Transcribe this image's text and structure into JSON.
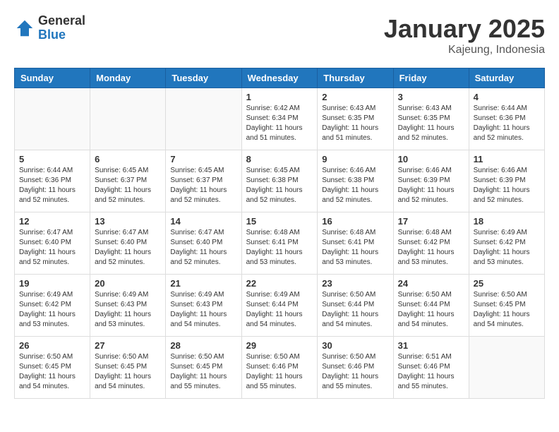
{
  "logo": {
    "general": "General",
    "blue": "Blue"
  },
  "title": "January 2025",
  "location": "Kajeung, Indonesia",
  "days_of_week": [
    "Sunday",
    "Monday",
    "Tuesday",
    "Wednesday",
    "Thursday",
    "Friday",
    "Saturday"
  ],
  "weeks": [
    [
      {
        "day": "",
        "sunrise": "",
        "sunset": "",
        "daylight": "",
        "empty": true
      },
      {
        "day": "",
        "sunrise": "",
        "sunset": "",
        "daylight": "",
        "empty": true
      },
      {
        "day": "",
        "sunrise": "",
        "sunset": "",
        "daylight": "",
        "empty": true
      },
      {
        "day": "1",
        "sunrise": "Sunrise: 6:42 AM",
        "sunset": "Sunset: 6:34 PM",
        "daylight": "Daylight: 11 hours and 51 minutes."
      },
      {
        "day": "2",
        "sunrise": "Sunrise: 6:43 AM",
        "sunset": "Sunset: 6:35 PM",
        "daylight": "Daylight: 11 hours and 51 minutes."
      },
      {
        "day": "3",
        "sunrise": "Sunrise: 6:43 AM",
        "sunset": "Sunset: 6:35 PM",
        "daylight": "Daylight: 11 hours and 52 minutes."
      },
      {
        "day": "4",
        "sunrise": "Sunrise: 6:44 AM",
        "sunset": "Sunset: 6:36 PM",
        "daylight": "Daylight: 11 hours and 52 minutes."
      }
    ],
    [
      {
        "day": "5",
        "sunrise": "Sunrise: 6:44 AM",
        "sunset": "Sunset: 6:36 PM",
        "daylight": "Daylight: 11 hours and 52 minutes."
      },
      {
        "day": "6",
        "sunrise": "Sunrise: 6:45 AM",
        "sunset": "Sunset: 6:37 PM",
        "daylight": "Daylight: 11 hours and 52 minutes."
      },
      {
        "day": "7",
        "sunrise": "Sunrise: 6:45 AM",
        "sunset": "Sunset: 6:37 PM",
        "daylight": "Daylight: 11 hours and 52 minutes."
      },
      {
        "day": "8",
        "sunrise": "Sunrise: 6:45 AM",
        "sunset": "Sunset: 6:38 PM",
        "daylight": "Daylight: 11 hours and 52 minutes."
      },
      {
        "day": "9",
        "sunrise": "Sunrise: 6:46 AM",
        "sunset": "Sunset: 6:38 PM",
        "daylight": "Daylight: 11 hours and 52 minutes."
      },
      {
        "day": "10",
        "sunrise": "Sunrise: 6:46 AM",
        "sunset": "Sunset: 6:39 PM",
        "daylight": "Daylight: 11 hours and 52 minutes."
      },
      {
        "day": "11",
        "sunrise": "Sunrise: 6:46 AM",
        "sunset": "Sunset: 6:39 PM",
        "daylight": "Daylight: 11 hours and 52 minutes."
      }
    ],
    [
      {
        "day": "12",
        "sunrise": "Sunrise: 6:47 AM",
        "sunset": "Sunset: 6:40 PM",
        "daylight": "Daylight: 11 hours and 52 minutes."
      },
      {
        "day": "13",
        "sunrise": "Sunrise: 6:47 AM",
        "sunset": "Sunset: 6:40 PM",
        "daylight": "Daylight: 11 hours and 52 minutes."
      },
      {
        "day": "14",
        "sunrise": "Sunrise: 6:47 AM",
        "sunset": "Sunset: 6:40 PM",
        "daylight": "Daylight: 11 hours and 52 minutes."
      },
      {
        "day": "15",
        "sunrise": "Sunrise: 6:48 AM",
        "sunset": "Sunset: 6:41 PM",
        "daylight": "Daylight: 11 hours and 53 minutes."
      },
      {
        "day": "16",
        "sunrise": "Sunrise: 6:48 AM",
        "sunset": "Sunset: 6:41 PM",
        "daylight": "Daylight: 11 hours and 53 minutes."
      },
      {
        "day": "17",
        "sunrise": "Sunrise: 6:48 AM",
        "sunset": "Sunset: 6:42 PM",
        "daylight": "Daylight: 11 hours and 53 minutes."
      },
      {
        "day": "18",
        "sunrise": "Sunrise: 6:49 AM",
        "sunset": "Sunset: 6:42 PM",
        "daylight": "Daylight: 11 hours and 53 minutes."
      }
    ],
    [
      {
        "day": "19",
        "sunrise": "Sunrise: 6:49 AM",
        "sunset": "Sunset: 6:42 PM",
        "daylight": "Daylight: 11 hours and 53 minutes."
      },
      {
        "day": "20",
        "sunrise": "Sunrise: 6:49 AM",
        "sunset": "Sunset: 6:43 PM",
        "daylight": "Daylight: 11 hours and 53 minutes."
      },
      {
        "day": "21",
        "sunrise": "Sunrise: 6:49 AM",
        "sunset": "Sunset: 6:43 PM",
        "daylight": "Daylight: 11 hours and 54 minutes."
      },
      {
        "day": "22",
        "sunrise": "Sunrise: 6:49 AM",
        "sunset": "Sunset: 6:44 PM",
        "daylight": "Daylight: 11 hours and 54 minutes."
      },
      {
        "day": "23",
        "sunrise": "Sunrise: 6:50 AM",
        "sunset": "Sunset: 6:44 PM",
        "daylight": "Daylight: 11 hours and 54 minutes."
      },
      {
        "day": "24",
        "sunrise": "Sunrise: 6:50 AM",
        "sunset": "Sunset: 6:44 PM",
        "daylight": "Daylight: 11 hours and 54 minutes."
      },
      {
        "day": "25",
        "sunrise": "Sunrise: 6:50 AM",
        "sunset": "Sunset: 6:45 PM",
        "daylight": "Daylight: 11 hours and 54 minutes."
      }
    ],
    [
      {
        "day": "26",
        "sunrise": "Sunrise: 6:50 AM",
        "sunset": "Sunset: 6:45 PM",
        "daylight": "Daylight: 11 hours and 54 minutes."
      },
      {
        "day": "27",
        "sunrise": "Sunrise: 6:50 AM",
        "sunset": "Sunset: 6:45 PM",
        "daylight": "Daylight: 11 hours and 54 minutes."
      },
      {
        "day": "28",
        "sunrise": "Sunrise: 6:50 AM",
        "sunset": "Sunset: 6:45 PM",
        "daylight": "Daylight: 11 hours and 55 minutes."
      },
      {
        "day": "29",
        "sunrise": "Sunrise: 6:50 AM",
        "sunset": "Sunset: 6:46 PM",
        "daylight": "Daylight: 11 hours and 55 minutes."
      },
      {
        "day": "30",
        "sunrise": "Sunrise: 6:50 AM",
        "sunset": "Sunset: 6:46 PM",
        "daylight": "Daylight: 11 hours and 55 minutes."
      },
      {
        "day": "31",
        "sunrise": "Sunrise: 6:51 AM",
        "sunset": "Sunset: 6:46 PM",
        "daylight": "Daylight: 11 hours and 55 minutes."
      },
      {
        "day": "",
        "sunrise": "",
        "sunset": "",
        "daylight": "",
        "empty": true
      }
    ]
  ]
}
